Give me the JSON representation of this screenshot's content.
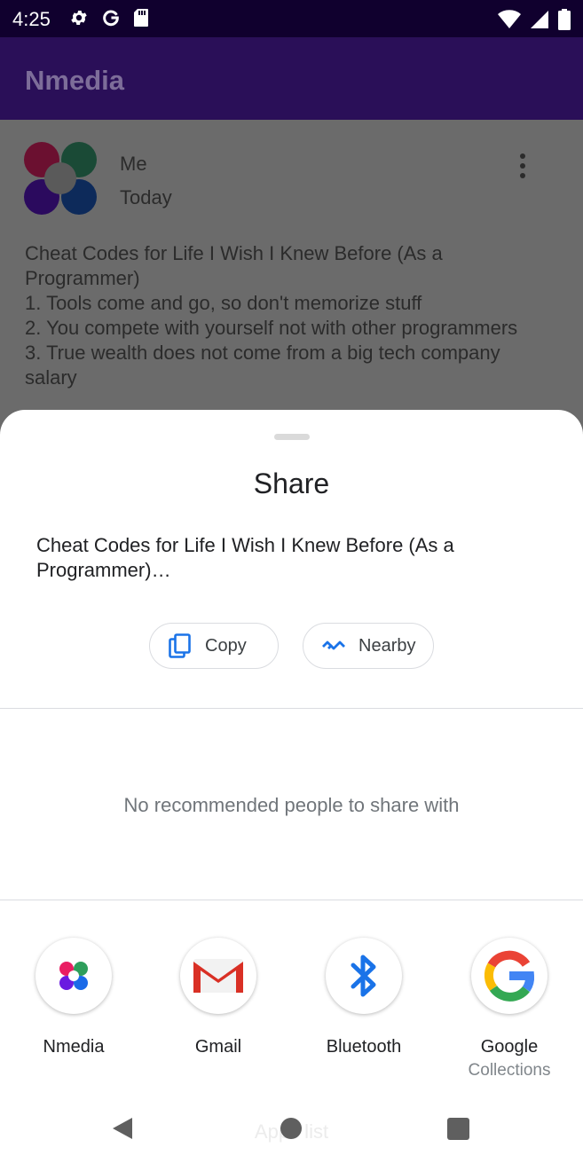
{
  "status_bar": {
    "time": "4:25",
    "left_icons": [
      "gear-icon",
      "google-g-icon",
      "sd-card-icon"
    ],
    "right_icons": [
      "wifi-icon",
      "signal-icon",
      "battery-icon"
    ]
  },
  "app_bar": {
    "title": "Nmedia"
  },
  "post": {
    "author": "Me",
    "date": "Today",
    "text": "Cheat Codes for Life I Wish I Knew Before (As a Programmer)\n1. Tools come and go, so don't memorize stuff\n2. You compete with yourself not with other programmers\n3. True wealth does not come from a big tech company salary"
  },
  "share_sheet": {
    "title": "Share",
    "preview_text": "Cheat Codes for Life I Wish I Knew Before (As a Programmer)…",
    "actions": [
      {
        "label": "Copy",
        "icon": "copy-icon"
      },
      {
        "label": "Nearby",
        "icon": "nearby-icon"
      }
    ],
    "empty_people_text": "No recommended people to share with",
    "targets": [
      {
        "label": "Nmedia",
        "sublabel": "",
        "icon": "nmedia-app-icon"
      },
      {
        "label": "Gmail",
        "sublabel": "",
        "icon": "gmail-icon"
      },
      {
        "label": "Bluetooth",
        "sublabel": "",
        "icon": "bluetooth-icon"
      },
      {
        "label": "Google",
        "sublabel": "Collections",
        "icon": "google-icon"
      }
    ],
    "ghost_text": "Apps list"
  },
  "colors": {
    "status_bar": "#10002e",
    "app_bar": "#2a0f58",
    "scrim": "#6b6b6b",
    "accent_blue": "#1a73e8"
  }
}
